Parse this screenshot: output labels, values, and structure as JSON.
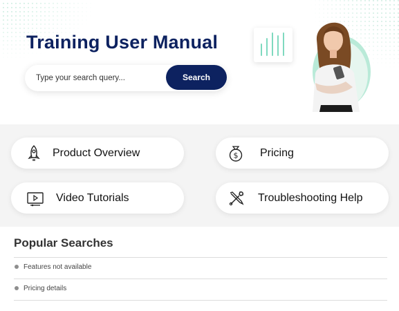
{
  "hero": {
    "title": "Training User Manual",
    "search": {
      "placeholder": "Type your search query...",
      "button_label": "Search"
    }
  },
  "categories": [
    {
      "label": "Product Overview",
      "icon": "rocket-icon"
    },
    {
      "label": "Pricing",
      "icon": "money-bag-icon"
    },
    {
      "label": "Video Tutorials",
      "icon": "video-player-icon"
    },
    {
      "label": "Troubleshooting Help",
      "icon": "wrench-screwdriver-icon"
    }
  ],
  "popular": {
    "heading": "Popular Searches",
    "items": [
      "Features not available",
      "Pricing details"
    ]
  },
  "colors": {
    "brand_navy": "#0d2260",
    "accent_mint": "#7fd9bf",
    "section_gray": "#f4f4f4"
  }
}
